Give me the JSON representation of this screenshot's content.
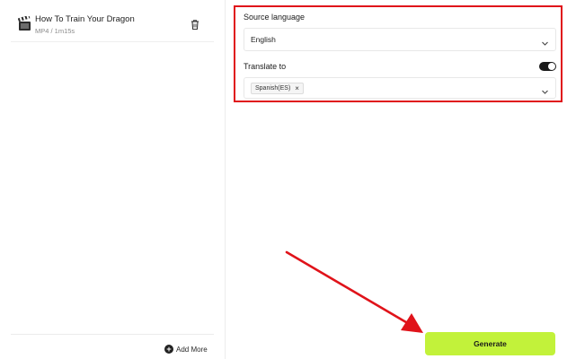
{
  "file": {
    "name": "How To Train Your Dragon",
    "meta": "MP4 / 1m15s"
  },
  "sidebar": {
    "add_more_label": "Add More"
  },
  "source": {
    "label": "Source language",
    "value": "English"
  },
  "translate": {
    "label": "Translate to",
    "toggle_on": true,
    "selected": [
      {
        "label": "Spanish(ES)",
        "remove_icon": "×"
      }
    ]
  },
  "actions": {
    "generate_label": "Generate"
  },
  "colors": {
    "highlight_border": "#e0131a",
    "generate_bg": "#c2f23a",
    "arrow": "#e0131a"
  },
  "icons": {
    "file": "clapperboard-icon",
    "delete": "trash-icon",
    "add": "plus-circle-icon",
    "dropdown": "chevron-down-icon"
  }
}
